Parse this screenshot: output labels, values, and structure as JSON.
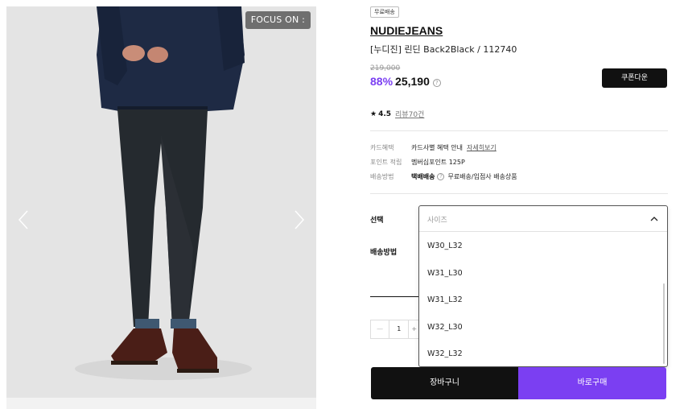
{
  "gallery": {
    "focus_badge": "FOCUS ON :",
    "prev_arrow_icon": "chevron-left-icon",
    "next_arrow_icon": "chevron-right-icon"
  },
  "product": {
    "shipping_badge": "무료배송",
    "brand": "NUDIEJEANS",
    "name": "[누디진] 린딘 Back2Black / 112740",
    "original_price": "219,000",
    "discount": "88%",
    "sale_price": "25,190",
    "coupon_button": "쿠폰다운",
    "rating": "4.5",
    "review_link": "리뷰70건"
  },
  "benefits": {
    "card_label": "카드혜택",
    "card_value": "카드사별 혜택 안내",
    "card_link": "자세히보기",
    "points_label": "포인트 적립",
    "points_value": "멤버십포인트 125P",
    "shipping_label": "배송방법",
    "shipping_method": "택배배송",
    "shipping_value": "무료배송/입점사 배송상품"
  },
  "options": {
    "select_label": "선택",
    "shipping_label": "배송방법",
    "dropdown_placeholder": "사이즈",
    "sizes": [
      "W30_L32",
      "W31_L30",
      "W31_L32",
      "W32_L30",
      "W32_L32"
    ],
    "quantity": "1"
  },
  "actions": {
    "cart_button": "장바구니",
    "buy_button": "바로구매"
  },
  "colors": {
    "accent": "#7b3ff2",
    "dark": "#111111"
  }
}
